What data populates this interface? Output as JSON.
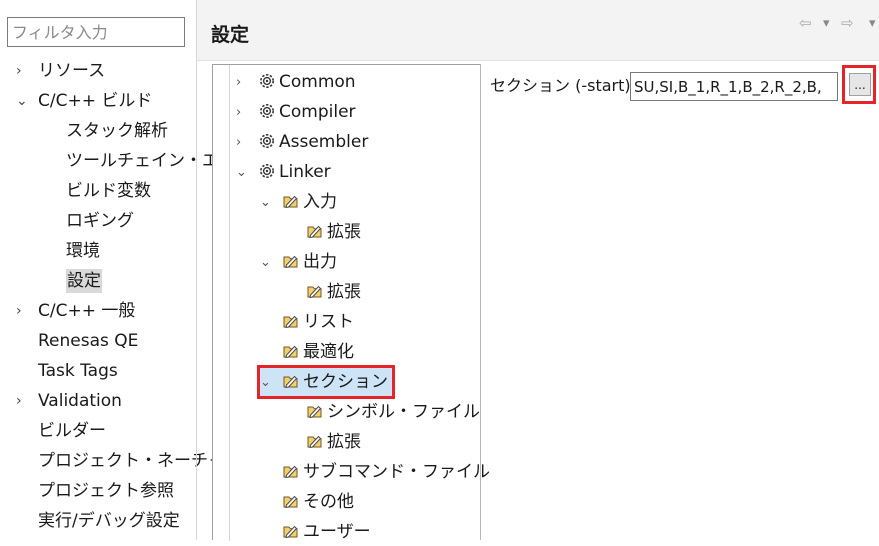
{
  "nav": {
    "filter_placeholder": "フィルタ入力",
    "items": [
      {
        "label": "リソース",
        "chevron": "›"
      },
      {
        "label": "C/C++ ビルド",
        "chevron": "⌄"
      },
      {
        "label": "スタック解析"
      },
      {
        "label": "ツールチェイン・エ"
      },
      {
        "label": "ビルド変数"
      },
      {
        "label": "ロギング"
      },
      {
        "label": "環境"
      },
      {
        "label": "設定"
      },
      {
        "label": "C/C++ 一般",
        "chevron": "›"
      },
      {
        "label": "Renesas QE"
      },
      {
        "label": "Task Tags"
      },
      {
        "label": "Validation",
        "chevron": "›"
      },
      {
        "label": "ビルダー"
      },
      {
        "label": "プロジェクト・ネーチャ"
      },
      {
        "label": "プロジェクト参照"
      },
      {
        "label": "実行/デバッグ設定"
      }
    ]
  },
  "header": {
    "title": "設定",
    "back_icon": "⇦",
    "dropdown_icon": "▾",
    "forward_icon": "⇨"
  },
  "tree": {
    "nodes": [
      {
        "label": "Common",
        "expander": "›",
        "icon": "gear-icon"
      },
      {
        "label": "Compiler",
        "expander": "›",
        "icon": "gear-icon"
      },
      {
        "label": "Assembler",
        "expander": "›",
        "icon": "gear-icon"
      },
      {
        "label": "Linker",
        "expander": "⌄",
        "icon": "gear-icon"
      },
      {
        "label": "入力",
        "expander": "⌄",
        "icon": "folder-icon"
      },
      {
        "label": "拡張",
        "icon": "folder-icon"
      },
      {
        "label": "出力",
        "expander": "⌄",
        "icon": "folder-icon"
      },
      {
        "label": "拡張",
        "icon": "folder-icon"
      },
      {
        "label": "リスト",
        "icon": "folder-icon"
      },
      {
        "label": "最適化",
        "icon": "folder-icon"
      },
      {
        "label": "セクション",
        "expander": "⌄",
        "icon": "folder-icon"
      },
      {
        "label": "シンボル・ファイル",
        "icon": "folder-icon"
      },
      {
        "label": "拡張",
        "icon": "folder-icon"
      },
      {
        "label": "サブコマンド・ファイル",
        "icon": "folder-icon"
      },
      {
        "label": "その他",
        "icon": "folder-icon"
      },
      {
        "label": "ユーザー",
        "icon": "folder-icon"
      }
    ]
  },
  "section": {
    "label": "セクション (-start)",
    "value": "SU,SI,B_1,R_1,B_2,R_2,B,",
    "browse_label": "..."
  },
  "colors": {
    "highlight_border": "#e52429",
    "selection_bg": "#cde4f7",
    "nav_selection_bg": "#d9d9d9",
    "header_bg": "#f3f3f3"
  }
}
